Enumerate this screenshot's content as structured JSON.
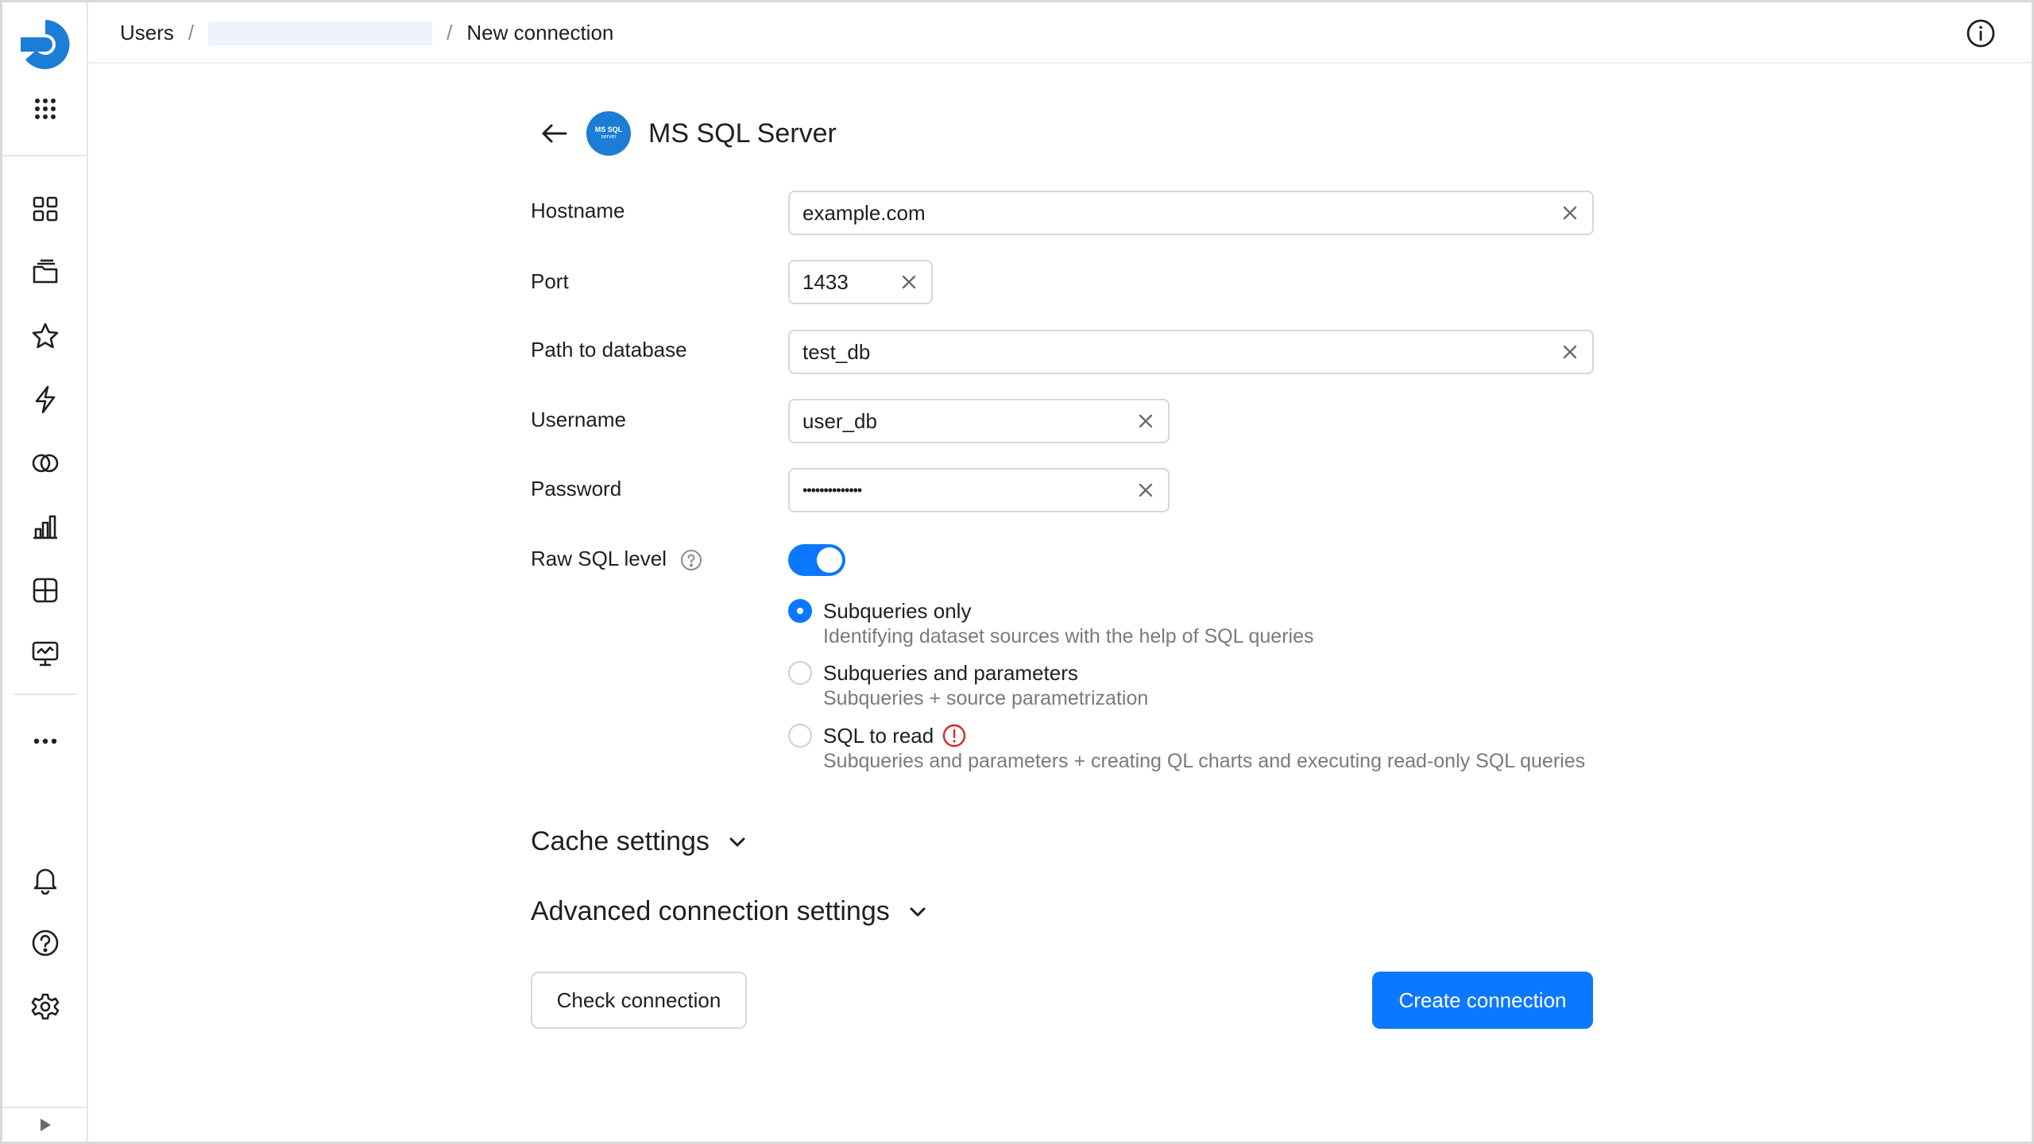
{
  "header": {
    "breadcrumbs": [
      {
        "label": "Users"
      },
      {
        "label": ""
      },
      {
        "label": "New connection"
      }
    ],
    "separator": "/"
  },
  "sidebar": {
    "items": [
      {
        "icon": "apps-grid-icon"
      },
      {
        "icon": "workbooks-icon"
      },
      {
        "icon": "favorites-star-icon"
      },
      {
        "icon": "connections-bolt-icon"
      },
      {
        "icon": "datasets-icon"
      },
      {
        "icon": "charts-icon"
      },
      {
        "icon": "dashboards-icon"
      },
      {
        "icon": "reports-icon"
      },
      {
        "icon": "more-dots-icon"
      }
    ],
    "bottom": [
      {
        "icon": "notifications-bell-icon"
      },
      {
        "icon": "help-icon"
      },
      {
        "icon": "settings-gear-icon"
      }
    ]
  },
  "connector": {
    "logo_text_line1": "MS SQL",
    "logo_text_line2": "server",
    "title": "MS SQL Server"
  },
  "form": {
    "hostname": {
      "label": "Hostname",
      "value": "example.com"
    },
    "port": {
      "label": "Port",
      "value": "1433"
    },
    "path": {
      "label": "Path to database",
      "value": "test_db"
    },
    "username": {
      "label": "Username",
      "value": "user_db"
    },
    "password": {
      "label": "Password",
      "value": "••••••••••••••"
    },
    "raw_sql": {
      "label": "Raw SQL level",
      "enabled": true
    },
    "raw_sql_options": [
      {
        "title": "Subqueries only",
        "description": "Identifying dataset sources with the help of SQL queries",
        "selected": true
      },
      {
        "title": "Subqueries and parameters",
        "description": "Subqueries + source parametrization",
        "selected": false
      },
      {
        "title": "SQL to read",
        "description": "Subqueries and parameters + creating QL charts and executing read-only SQL queries",
        "selected": false,
        "warning": true
      }
    ],
    "cache_settings": "Cache settings",
    "advanced_settings": "Advanced connection settings"
  },
  "actions": {
    "check": "Check connection",
    "create": "Create connection"
  },
  "colors": {
    "accent": "#0b78ff",
    "warning": "#d9262b",
    "muted_text": "#7a7a7a"
  }
}
